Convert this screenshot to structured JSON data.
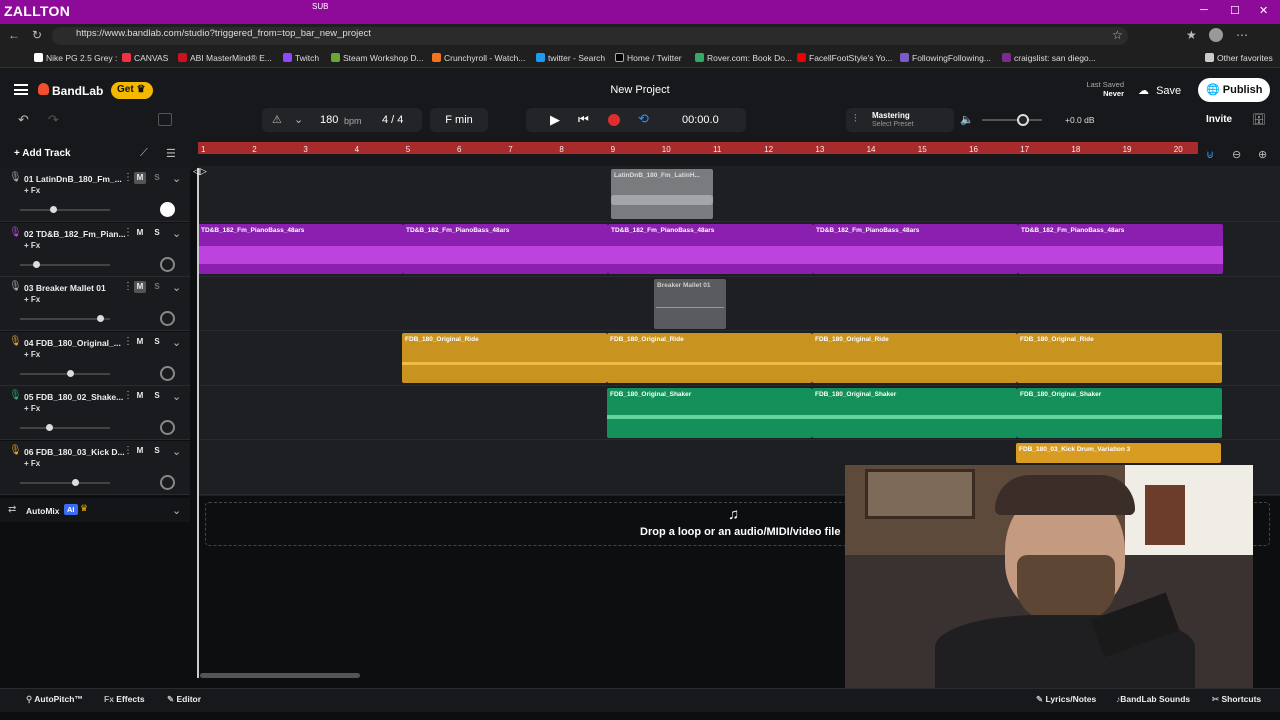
{
  "browser": {
    "profile_name": "ZALLTON",
    "sub_label": "SUB",
    "url": "https://www.bandlab.com/studio?triggered_from=top_bar_new_project",
    "bookmarks": [
      "Nike PG 2.5 Grey :",
      "CANVAS",
      "ABI MasterMind® E...",
      "Twitch",
      "Steam Workshop D...",
      "Crunchyroll - Watch...",
      "twitter - Search",
      "Home / Twitter",
      "Rover.com: Book Do...",
      "FacellFootStyle's Yo...",
      "FollowingFollowing...",
      "craigslist: san diego..."
    ],
    "other_favorites": "Other favorites"
  },
  "app": {
    "logo": "BandLab",
    "get_label": "Get",
    "project_title": "New Project",
    "last_saved_label": "Last Saved",
    "last_saved_value": "Never",
    "save_label": "Save",
    "publish_label": "Publish",
    "invite_label": "Invite"
  },
  "toolbar": {
    "bpm_value": "180",
    "bpm_unit": "bpm",
    "time_signature": "4 / 4",
    "key": "F min",
    "time": "00:00.0",
    "mastering_label": "Mastering",
    "mastering_preset": "Select Preset",
    "gain": "+0.0 dB",
    "add_track": "Add Track"
  },
  "ruler": [
    "1",
    "2",
    "3",
    "4",
    "5",
    "6",
    "7",
    "8",
    "9",
    "10",
    "11",
    "12",
    "13",
    "14",
    "15",
    "16",
    "17",
    "18",
    "19",
    "20"
  ],
  "tracks": [
    {
      "name": "01  LatinDnB_180_Fm_...",
      "fx": "+ Fx",
      "m": "M",
      "s": "S",
      "color": "#aaaaaa",
      "volume": 0.35
    },
    {
      "name": "02  TD&B_182_Fm_Pian...",
      "fx": "+ Fx",
      "m": "M",
      "s": "S",
      "color": "#b44bd6",
      "volume": 0.15
    },
    {
      "name": "03  Breaker Mallet 01",
      "fx": "+ Fx",
      "m": "M",
      "s": "S",
      "color": "#aaaaaa",
      "volume": 0.9
    },
    {
      "name": "04  FDB_180_Original_...",
      "fx": "+ Fx",
      "m": "M",
      "s": "S",
      "color": "#e0a62a",
      "volume": 0.55
    },
    {
      "name": "05  FDB_180_02_Shake...",
      "fx": "+ Fx",
      "m": "M",
      "s": "S",
      "color": "#2fae6e",
      "volume": 0.3
    },
    {
      "name": "06  FDB_180_03_Kick D...",
      "fx": "+ Fx",
      "m": "M",
      "s": "S",
      "color": "#e0a62a",
      "volume": 0.6
    }
  ],
  "clips": {
    "latin": "LatinDnB_180_Fm_LatinH...",
    "piano": "TD&B_182_Fm_PianoBass_48ars",
    "mallet": "Breaker Mallet 01",
    "ride": "FDB_180_Original_Ride",
    "shaker": "FDB_180_Original_Shaker",
    "kick": "FDB_180_03_Kick Drum_Variation 3"
  },
  "automix": {
    "label": "AutoMix",
    "badge": "AI"
  },
  "dropzone": "Drop a loop or an audio/MIDI/video file",
  "bottom": {
    "autopitch": "AutoPitch™",
    "effects": "Effects",
    "editor": "Editor",
    "lyrics": "Lyrics/Notes",
    "sounds": "BandLab Sounds",
    "shortcuts": "Shortcuts"
  }
}
